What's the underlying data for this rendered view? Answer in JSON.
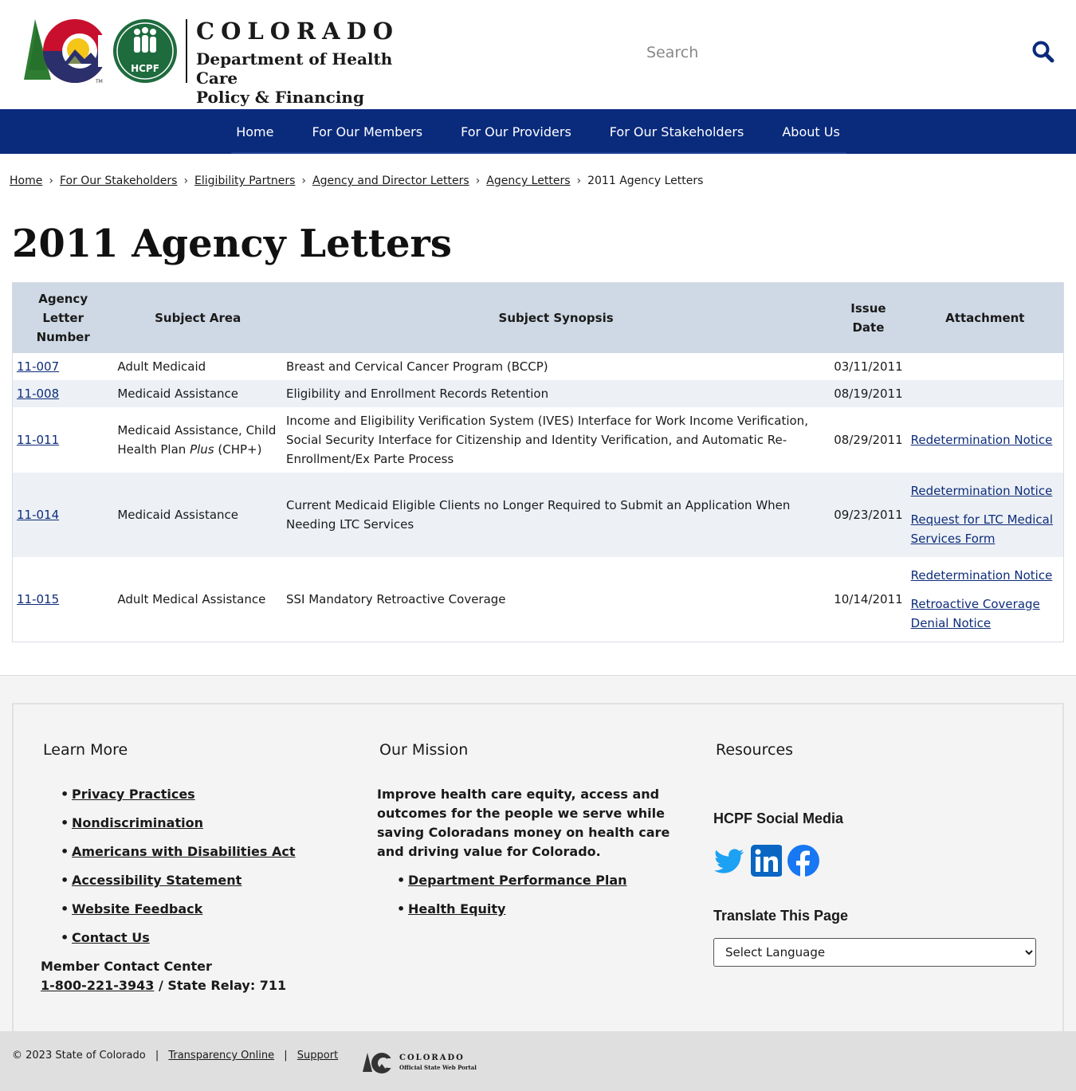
{
  "header": {
    "logo": {
      "state": "COLORADO",
      "dept_line1": "Department of Health Care",
      "dept_line2": "Policy & Financing",
      "badge": "HCPF",
      "tm": "TM"
    },
    "search": {
      "placeholder": "Search",
      "icon": "search-icon"
    }
  },
  "nav": [
    "Home",
    "For Our Members",
    "For Our Providers",
    "For Our Stakeholders",
    "About Us"
  ],
  "breadcrumb": [
    "Home",
    "For Our Stakeholders",
    "Eligibility Partners",
    "Agency and Director Letters",
    "Agency Letters",
    "2011 Agency Letters"
  ],
  "page_title": "2011 Agency Letters",
  "table": {
    "headers": [
      "Agency Letter Number",
      "Subject Area",
      "Subject Synopsis",
      "Issue Date",
      "Attachment"
    ],
    "rows": [
      {
        "number": "11-007",
        "area": "Adult Medicaid",
        "synopsis": "Breast and Cervical Cancer Program (BCCP)",
        "date": "03/11/2011",
        "attachments": []
      },
      {
        "number": "11-008",
        "area": "Medicaid Assistance",
        "synopsis": "Eligibility and Enrollment Records Retention",
        "date": "08/19/2011",
        "attachments": []
      },
      {
        "number": "11-011",
        "area": "Medicaid Assistance, Child Health Plan",
        "area_italic": "Plus",
        "area_suffix": "(CHP+)",
        "synopsis": "Income and Eligibility Verification System (IVES) Interface for Work Income Verification, Social Security Interface for Citizenship and Identity Verification, and Automatic Re-Enrollment/Ex Parte Process",
        "date": "08/29/2011",
        "attachments": [
          "Redetermination Notice"
        ]
      },
      {
        "number": "11-014",
        "area": "Medicaid Assistance",
        "synopsis": "Current Medicaid Eligible Clients no Longer Required to Submit an Application When Needing LTC Services",
        "date": "09/23/2011",
        "attachments": [
          "Redetermination Notice",
          "Request for LTC Medical Services Form"
        ]
      },
      {
        "number": "11-015",
        "area": "Adult Medical Assistance",
        "synopsis": "SSI Mandatory Retroactive Coverage",
        "date": "10/14/2011",
        "attachments": [
          "Redetermination Notice",
          "Retroactive Coverage Denial Notice"
        ]
      }
    ]
  },
  "footer": {
    "learn_more": {
      "title": "Learn More",
      "links": [
        "Privacy Practices",
        "Nondiscrimination",
        "Americans with Disabilities Act",
        "Accessibility Statement",
        "Website Feedback",
        "Contact Us"
      ],
      "contact_label": "Member Contact Center",
      "phone": "1-800-221-3943",
      "relay": "/ State Relay: 711"
    },
    "mission": {
      "title": "Our Mission",
      "text": "Improve health care equity, access and outcomes for the people we serve while saving Coloradans money on health care and driving value for Colorado.",
      "links": [
        "Department Performance Plan",
        "Health Equity"
      ]
    },
    "resources": {
      "title": "Resources",
      "social_title": "HCPF Social Media",
      "social": [
        "twitter-icon",
        "linkedin-icon",
        "facebook-icon"
      ],
      "translate_title": "Translate This Page",
      "language_selected": "Select Language"
    }
  },
  "copyright": {
    "text": "© 2023 State of Colorado",
    "links": [
      "Transparency Online",
      "Support"
    ],
    "portal_line1": "COLORADO",
    "portal_line2": "Official State Web Portal"
  },
  "colors": {
    "nav": "#0a2a7c",
    "link": "#0d2c7a",
    "table_header": "#cfd9e5",
    "row_alt": "#edf1f6"
  }
}
